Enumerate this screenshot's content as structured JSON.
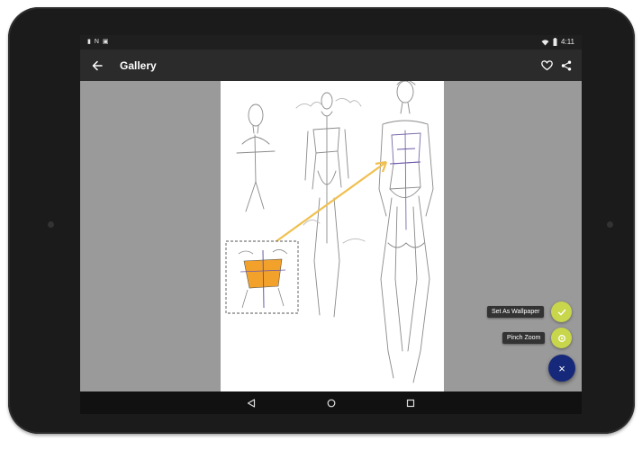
{
  "status": {
    "time": "4:11",
    "left_icons": [
      "▮",
      "N",
      "▣"
    ]
  },
  "appbar": {
    "title": "Gallery"
  },
  "fab": {
    "set_wallpaper_label": "Set As Wallpaper",
    "pinch_zoom_label": "Pinch Zoom",
    "close_glyph": "×"
  },
  "colors": {
    "fab_accent": "#c7d64a",
    "fab_main": "#16287a",
    "highlight_orange": "#f2a12a",
    "arrow_yellow": "#f0c050"
  },
  "icons": [
    "back-arrow-icon",
    "heart-icon",
    "share-icon",
    "check-icon",
    "zoom-icon",
    "close-icon",
    "nav-back-icon",
    "nav-home-icon",
    "nav-recents-icon",
    "wifi-icon",
    "battery-icon"
  ]
}
